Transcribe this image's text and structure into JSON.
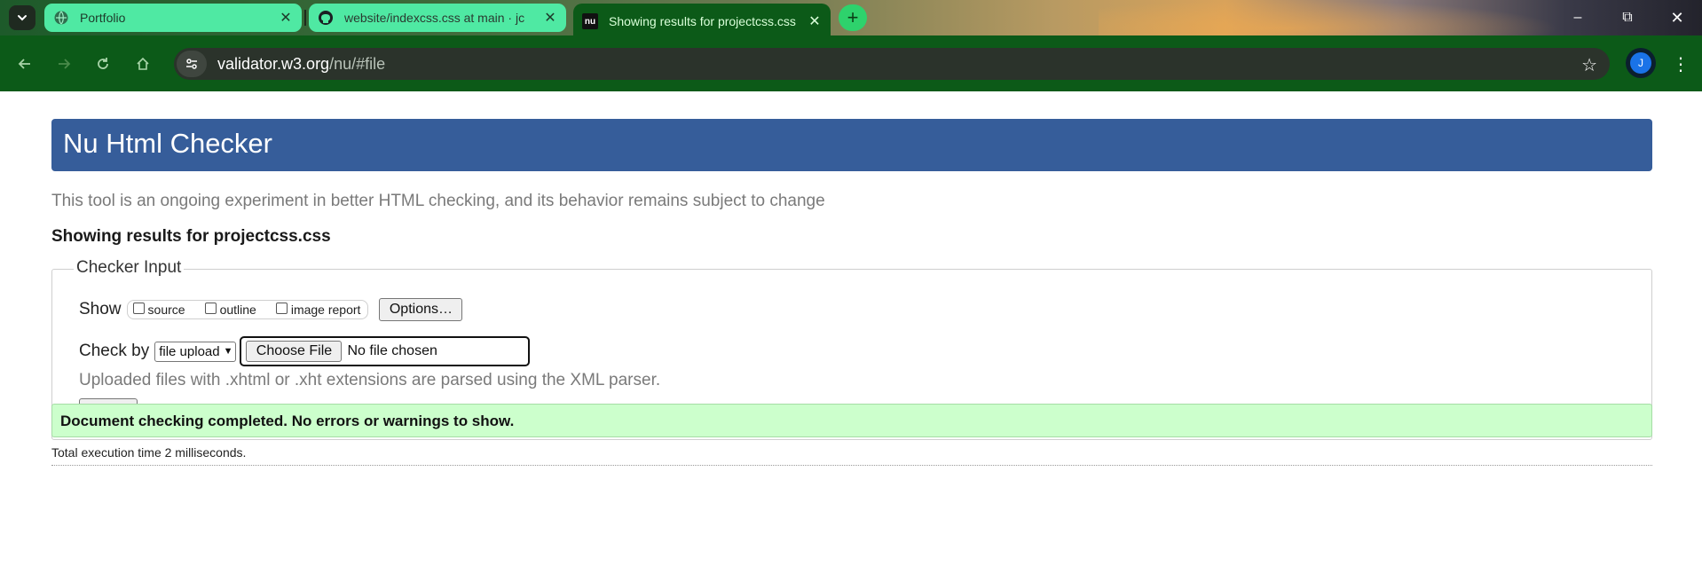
{
  "browser": {
    "tabs": [
      {
        "title": "Portfolio",
        "active": false,
        "favicon": "globe-icon"
      },
      {
        "title": "website/indexcss.css at main · jc",
        "active": false,
        "favicon": "github-icon"
      },
      {
        "title": "Showing results for projectcss.css",
        "active": true,
        "favicon": "nu-icon",
        "favicon_text": "nu"
      }
    ],
    "window_controls": {
      "minimize": "–",
      "maximize": "⧉",
      "close": "✕"
    },
    "address": {
      "host": "validator.w3.org",
      "path": "/nu/#file"
    },
    "profile_initial": "J",
    "colors": {
      "toolbar": "#0c5a18",
      "tab_inactive": "#4fe9a3",
      "new_tab": "#2ed26c"
    }
  },
  "page": {
    "heading": "Nu Html Checker",
    "subtitle": "This tool is an ongoing experiment in better HTML checking, and its behavior remains subject to change",
    "results_for": "Showing results for projectcss.css",
    "checker": {
      "legend": "Checker Input",
      "show_label": "Show",
      "show_options": [
        {
          "label": "source",
          "checked": false
        },
        {
          "label": "outline",
          "checked": false
        },
        {
          "label": "image report",
          "checked": false
        }
      ],
      "options_button": "Options…",
      "check_by_label": "Check by",
      "check_by_selected": "file upload",
      "choose_file_button": "Choose File",
      "file_status": "No file chosen",
      "note": "Uploaded files with .xhtml or .xht extensions are parsed using the XML parser.",
      "check_button": "Check"
    },
    "result_message": "Document checking completed. No errors or warnings to show.",
    "execution_time": "Total execution time 2 milliseconds.",
    "colors": {
      "header": "#365d9a",
      "success": "#ccffcc"
    }
  }
}
